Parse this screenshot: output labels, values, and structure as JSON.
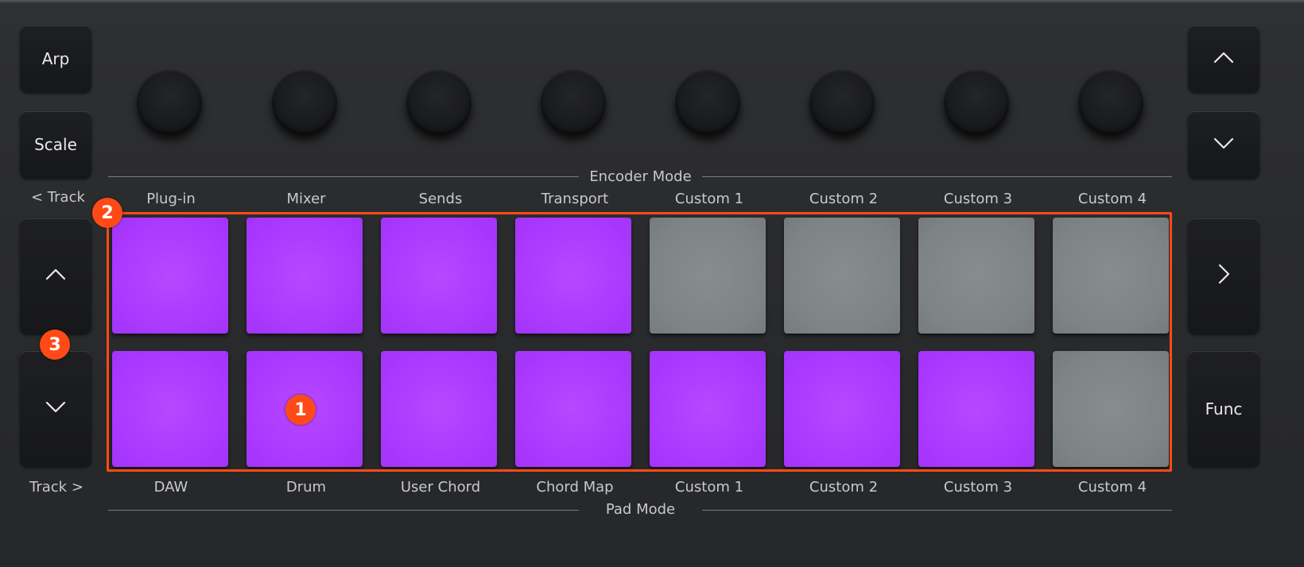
{
  "left_buttons": {
    "arp": "Arp",
    "scale": "Scale",
    "track_prev_label": "< Track",
    "track_next_label": "Track >"
  },
  "right_buttons": {
    "func": "Func"
  },
  "encoder_section": {
    "title": "Encoder Mode",
    "labels": [
      "Plug-in",
      "Mixer",
      "Sends",
      "Transport",
      "Custom 1",
      "Custom 2",
      "Custom 3",
      "Custom 4"
    ]
  },
  "pad_section": {
    "title": "Pad Mode",
    "labels": [
      "DAW",
      "Drum",
      "User Chord",
      "Chord Map",
      "Custom 1",
      "Custom 2",
      "Custom 3",
      "Custom 4"
    ]
  },
  "pads": {
    "top_row_colors": [
      "purple",
      "purple",
      "purple",
      "purple",
      "grey",
      "grey",
      "grey",
      "grey"
    ],
    "bottom_row_colors": [
      "purple",
      "purple",
      "purple",
      "purple",
      "purple",
      "purple",
      "purple",
      "grey"
    ]
  },
  "callouts": [
    "1",
    "2",
    "3"
  ],
  "colors": {
    "pad_purple": "#aa38ff",
    "pad_grey": "#7e8484",
    "callout_orange": "#ff4a17",
    "body": "#2a2b2d"
  },
  "icons": {
    "up": "chevron-up-icon",
    "down": "chevron-down-icon",
    "right": "chevron-right-icon"
  }
}
